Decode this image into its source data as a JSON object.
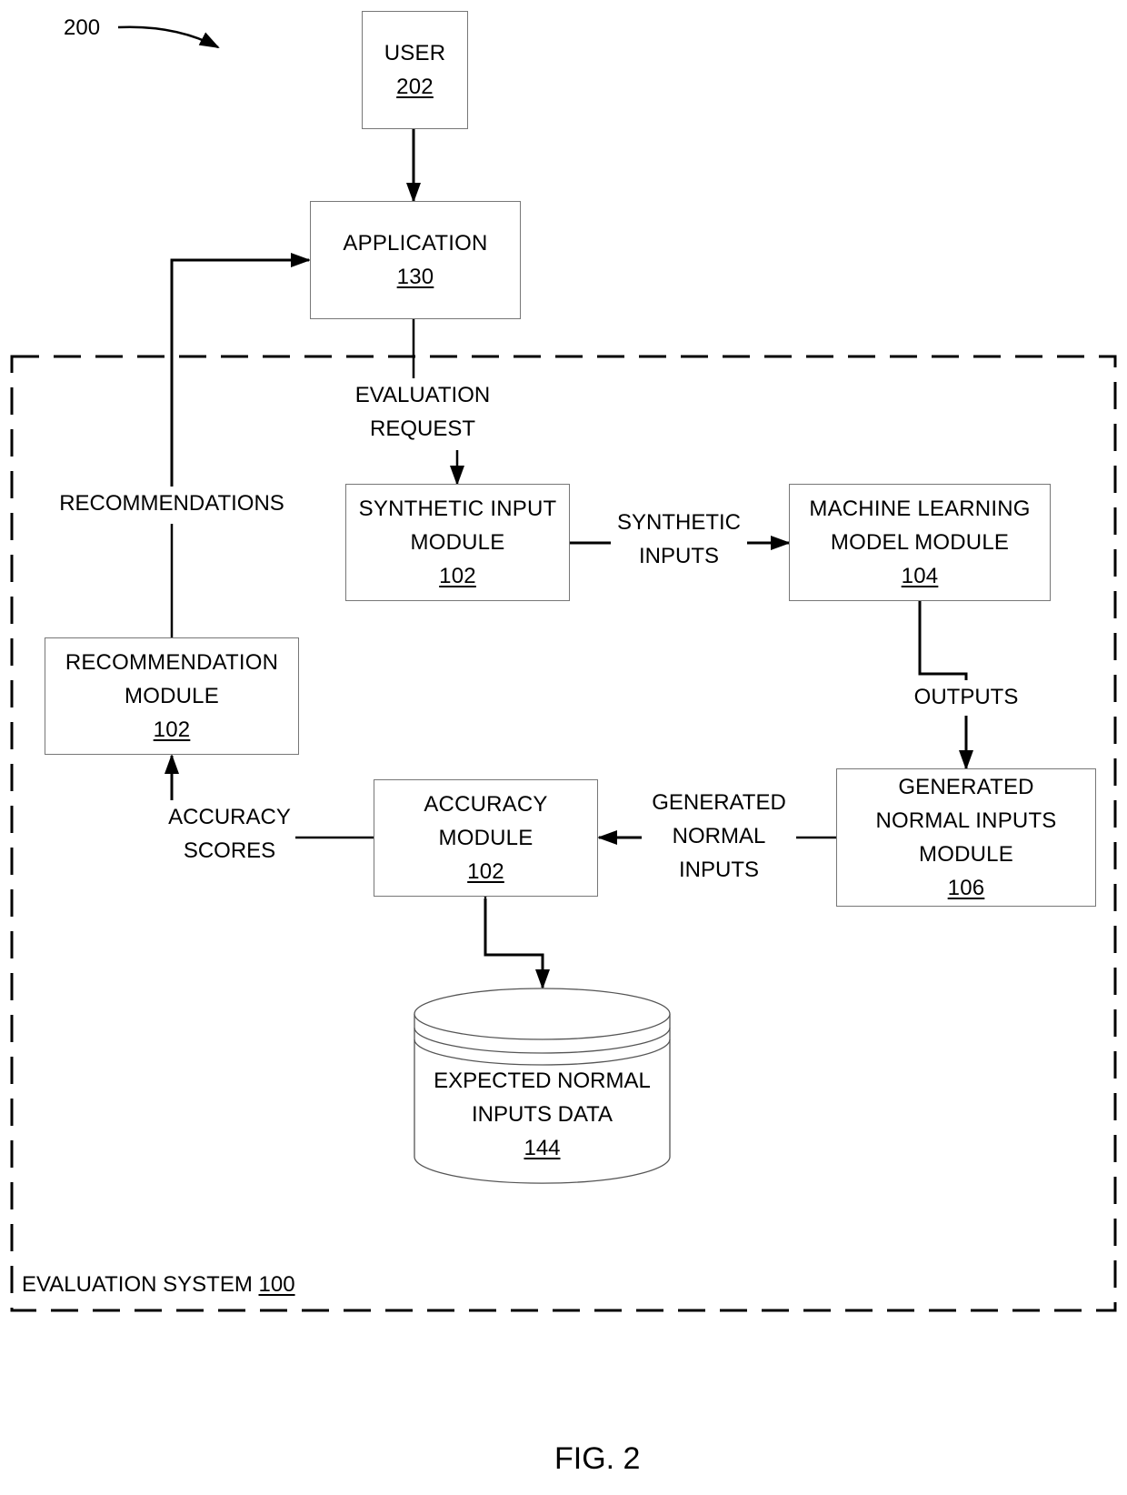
{
  "figure": {
    "number_label": "200",
    "caption": "FIG. 2"
  },
  "system": {
    "name": "EVALUATION SYSTEM",
    "ref": "100"
  },
  "nodes": {
    "user": {
      "lines": [
        "USER"
      ],
      "ref": "202"
    },
    "application": {
      "lines": [
        "APPLICATION"
      ],
      "ref": "130"
    },
    "synthetic_input_module": {
      "lines": [
        "SYNTHETIC INPUT",
        "MODULE"
      ],
      "ref": "102"
    },
    "ml_model_module": {
      "lines": [
        "MACHINE LEARNING",
        "MODEL MODULE"
      ],
      "ref": "104"
    },
    "generated_normal_inputs_module": {
      "lines": [
        "GENERATED",
        "NORMAL INPUTS",
        "MODULE"
      ],
      "ref": "106"
    },
    "accuracy_module": {
      "lines": [
        "ACCURACY",
        "MODULE"
      ],
      "ref": "102"
    },
    "recommendation_module": {
      "lines": [
        "RECOMMENDATION",
        "MODULE"
      ],
      "ref": "102"
    },
    "expected_normal_inputs_data": {
      "lines": [
        "EXPECTED NORMAL",
        "INPUTS DATA"
      ],
      "ref": "144"
    }
  },
  "edges": {
    "evaluation_request": [
      "EVALUATION",
      "REQUEST"
    ],
    "synthetic_inputs": [
      "SYNTHETIC",
      "INPUTS"
    ],
    "outputs": [
      "OUTPUTS"
    ],
    "generated_normal_inputs": [
      "GENERATED",
      "NORMAL",
      "INPUTS"
    ],
    "accuracy_scores": [
      "ACCURACY",
      "SCORES"
    ],
    "recommendations": [
      "RECOMMENDATIONS"
    ]
  }
}
